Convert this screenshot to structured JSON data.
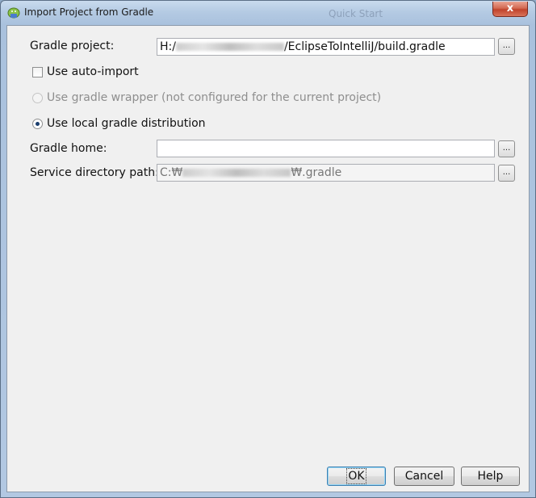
{
  "window": {
    "title": "Import Project from Gradle",
    "background_title": "Quick Start",
    "close_glyph": "x"
  },
  "form": {
    "gradle_project": {
      "label": "Gradle project:",
      "value_prefix": "H:/",
      "value_suffix": "/EclipseToIntelliJ/build.gradle",
      "browse_label": "..."
    },
    "auto_import": {
      "label": "Use auto-import",
      "checked": false
    },
    "use_wrapper": {
      "label": "Use gradle wrapper (not configured for the current project)",
      "enabled": false,
      "selected": false
    },
    "use_local": {
      "label": "Use local gradle distribution",
      "selected": true
    },
    "gradle_home": {
      "label": "Gradle home:",
      "value": "",
      "browse_label": "..."
    },
    "service_dir": {
      "label": "Service directory path:",
      "value_prefix": "C:₩",
      "value_suffix": "₩.gradle",
      "browse_label": "..."
    }
  },
  "buttons": {
    "ok": "OK",
    "cancel": "Cancel",
    "help": "Help"
  },
  "colors": {
    "client_bg": "#f0f0f0",
    "frame": "#b2c8e2",
    "close": "#c0432c",
    "radio_dot": "#1b3e6e"
  }
}
